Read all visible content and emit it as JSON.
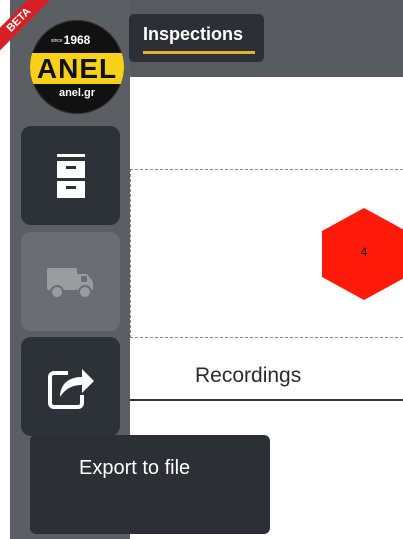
{
  "header": {
    "tab_label": "Inspections"
  },
  "logo": {
    "since_text": "since",
    "year": "1968",
    "brand": "ANEL",
    "domain": "anel.gr",
    "badge": "BETA"
  },
  "sidebar": {
    "items": [
      {
        "icon": "archive-drawer-icon",
        "enabled": true
      },
      {
        "icon": "truck-icon",
        "enabled": false
      },
      {
        "icon": "export-share-icon",
        "enabled": true
      }
    ]
  },
  "main": {
    "hex_marker_value": "4",
    "section_title": "Recordings"
  },
  "tooltip": {
    "text": "Export to file"
  },
  "colors": {
    "sidebar_bg": "#5b5e63",
    "button_bg": "#2d3138",
    "accent_underline": "#e3b12e",
    "hex_red": "#ff1a0a",
    "logo_yellow": "#f7d117",
    "beta_red": "#d62026"
  }
}
